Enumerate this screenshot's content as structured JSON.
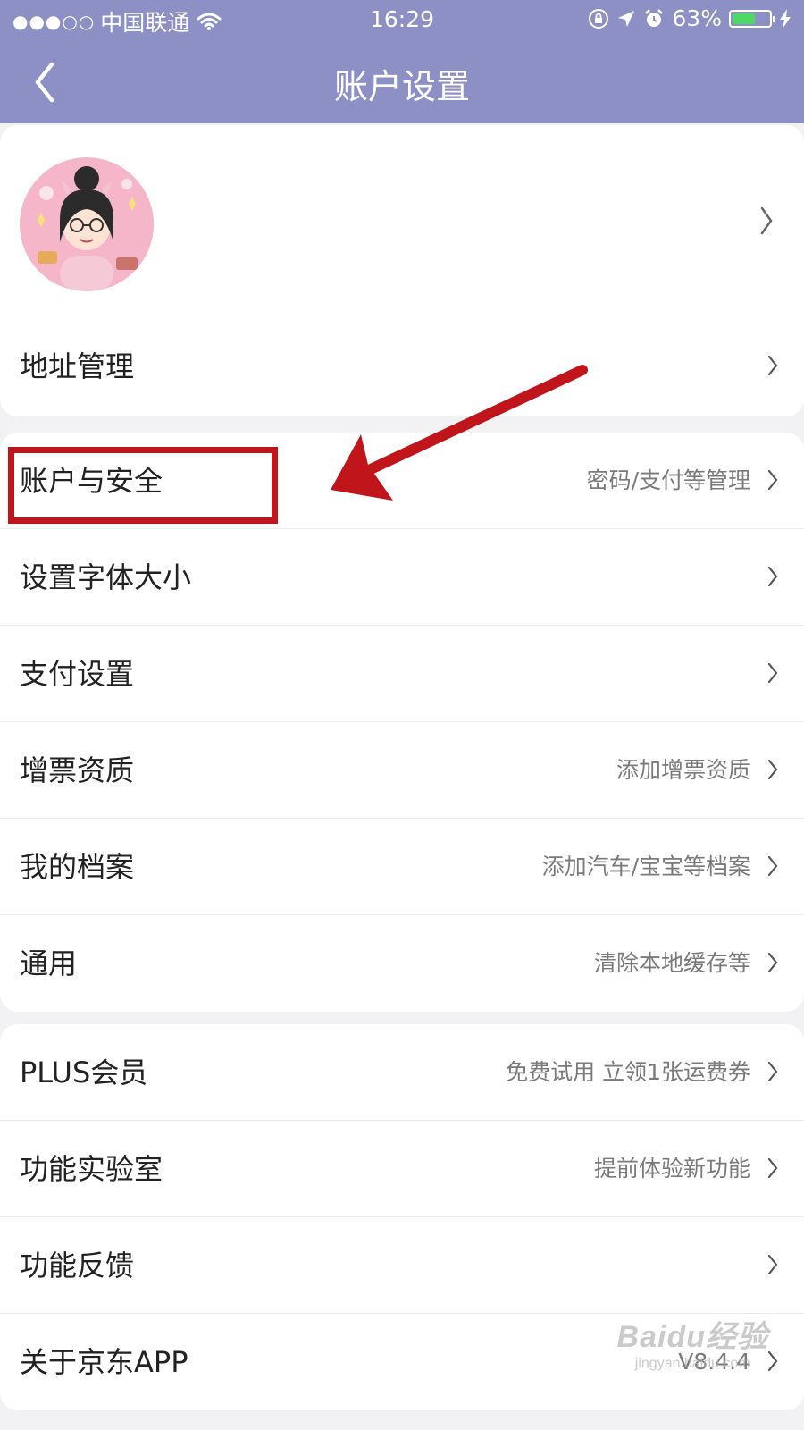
{
  "status_bar": {
    "signal": "●●●○○",
    "carrier": "中国联通",
    "time": "16:29",
    "battery": "63%",
    "battery_level": 0.63,
    "icons": [
      "wifi-icon",
      "lock-rotation-icon",
      "location-icon",
      "alarm-icon",
      "battery-icon",
      "charging-icon"
    ]
  },
  "nav": {
    "title": "账户设置"
  },
  "profile": {
    "avatar_alt": "avatar"
  },
  "group1": {
    "items": [
      {
        "label": "地址管理",
        "value": ""
      }
    ]
  },
  "group2": {
    "items": [
      {
        "label": "账户与安全",
        "value": "密码/支付等管理"
      },
      {
        "label": "设置字体大小",
        "value": ""
      },
      {
        "label": "支付设置",
        "value": ""
      },
      {
        "label": "增票资质",
        "value": "添加增票资质"
      },
      {
        "label": "我的档案",
        "value": "添加汽车/宝宝等档案"
      },
      {
        "label": "通用",
        "value": "清除本地缓存等"
      }
    ]
  },
  "group3": {
    "items": [
      {
        "label": "PLUS会员",
        "value": "免费试用 立领1张运费券"
      },
      {
        "label": "功能实验室",
        "value": "提前体验新功能"
      },
      {
        "label": "功能反馈",
        "value": ""
      },
      {
        "label": "关于京东APP",
        "value": "V8.4.4"
      }
    ]
  },
  "watermark": {
    "main": "Baidu经验",
    "sub": "jingyan.baidu.com"
  },
  "colors": {
    "header": "#8d90c5",
    "annotation": "#c0151b",
    "background": "#f2f2f4"
  }
}
